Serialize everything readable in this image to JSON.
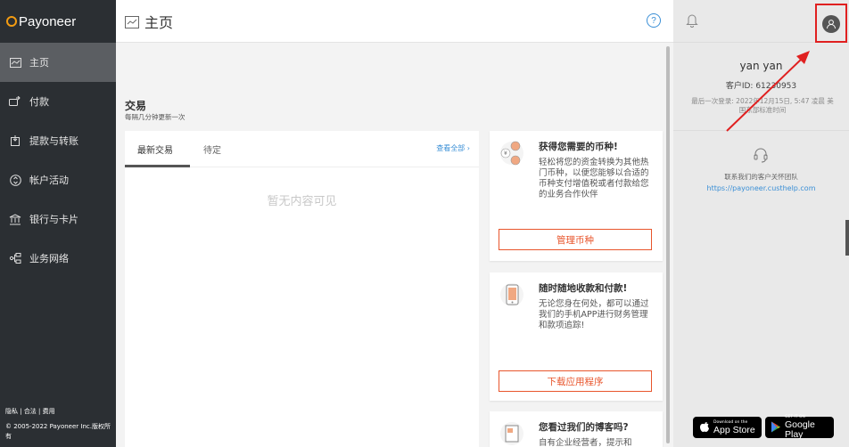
{
  "brand": {
    "name": "Payoneer"
  },
  "sidebar": {
    "items": [
      {
        "label": "主页",
        "icon": "home-icon"
      },
      {
        "label": "付款",
        "icon": "payment-icon"
      },
      {
        "label": "提款与转账",
        "icon": "withdraw-icon"
      },
      {
        "label": "帐户活动",
        "icon": "activity-icon"
      },
      {
        "label": "银行与卡片",
        "icon": "bank-icon"
      },
      {
        "label": "业务网络",
        "icon": "network-icon"
      }
    ],
    "footer": {
      "privacy": "隐私",
      "legal": "合法",
      "fees": "费用",
      "copyright": "© 2005-2022 Payoneer Inc.版权所有"
    }
  },
  "header": {
    "title": "主页",
    "help_icon": "help-icon"
  },
  "transactions": {
    "title": "交易",
    "subtitle": "每隔几分钟更新一次",
    "tab_latest": "最新交易",
    "tab_pending": "待定",
    "view_all": "查看全部 ›",
    "empty": "暂无内容可见"
  },
  "promos": [
    {
      "title": "获得您需要的币种!",
      "desc": "轻松将您的资金转换为其他热门币种，以便您能够以合适的币种支付增值税或者付款给您的业务合作伙伴",
      "button": "管理币种"
    },
    {
      "title": "随时随地收款和付款!",
      "desc": "无论您身在何处，都可以通过我们的手机APP进行财务管理和款项追踪!",
      "button": "下载应用程序"
    },
    {
      "title": "您看过我们的博客吗?",
      "desc": "自有企业经营者，提示和"
    }
  ],
  "profile": {
    "name": "yan yan",
    "customer_id": "客户ID: 61230953",
    "last_login": "最后一次登录: 2022年12月15日, 5:47 凌晨 美国东部标准时间"
  },
  "support": {
    "label": "联系我们的客户关怀团队",
    "link": "https://payoneer.custhelp.com"
  },
  "stores": {
    "apple_small": "Download on the",
    "apple_big": "App Store",
    "google_small": "GET IT ON",
    "google_big": "Google Play"
  },
  "colors": {
    "accent": "#e8552c",
    "link": "#3a8fd6",
    "sidebar": "#2b2f33",
    "highlight": "#e02020"
  }
}
